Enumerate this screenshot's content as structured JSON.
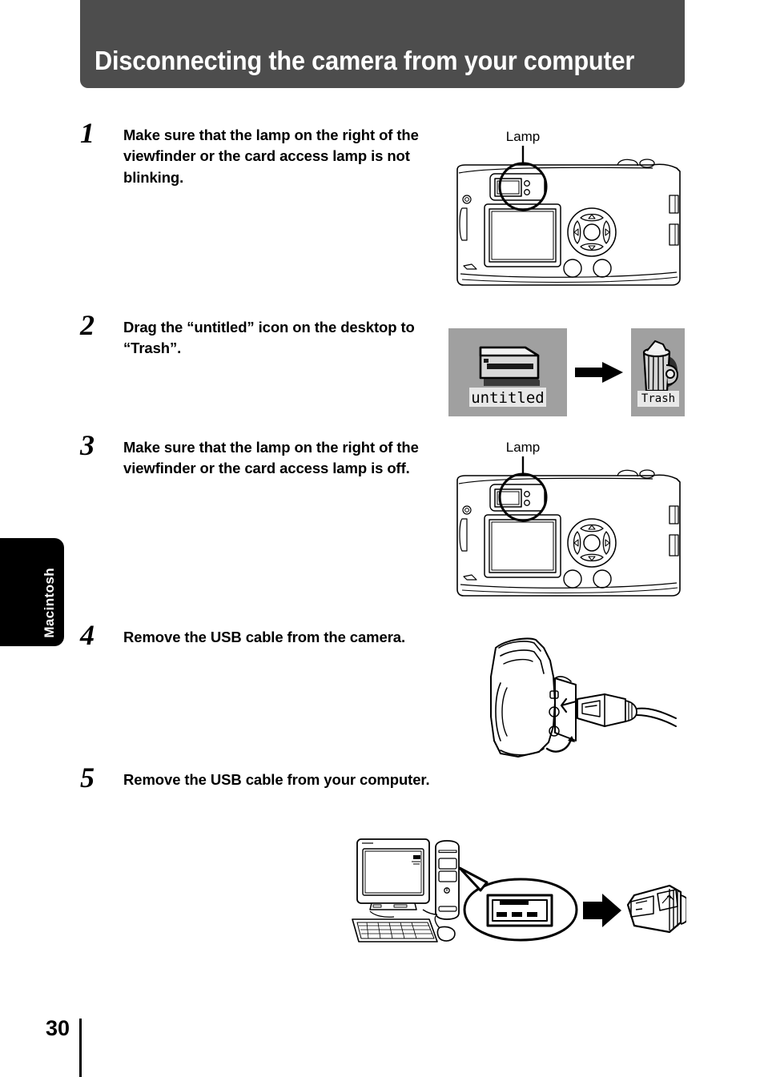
{
  "page": {
    "title": "Disconnecting the camera from your computer",
    "number": "30",
    "side_tab_label": "Macintosh"
  },
  "steps": [
    {
      "number": "1",
      "text": "Make sure that the lamp on the right of the viewfinder or the card access lamp is not blinking.",
      "figure": "camera-rear-view-with-lamp-callout",
      "figure_label": "Lamp"
    },
    {
      "number": "2",
      "text": "Drag the “untitled” icon on the desktop to “Trash”.",
      "figure": "untitled-icon-dragged-to-trash",
      "icons": {
        "source_label": "untitled",
        "target_label": "Trash"
      }
    },
    {
      "number": "3",
      "text": "Make sure that the lamp on the right of the viewfinder or the card access lamp is off.",
      "figure": "camera-rear-view-with-lamp-callout",
      "figure_label": "Lamp"
    },
    {
      "number": "4",
      "text": "Remove the USB cable from the camera.",
      "figure": "camera-side-usb-port-with-cable"
    },
    {
      "number": "5",
      "text": "Remove the USB cable from your computer.",
      "figure": "desktop-computer-usb-port-with-plug"
    }
  ],
  "colors": {
    "header_background": "#4d4d4d",
    "header_text": "#ffffff",
    "side_tab_background": "#000000",
    "side_tab_text": "#ffffff",
    "desktop_icon_background": "#a0a0a0",
    "icon_caption_background": "#e8e8e8",
    "line_art": "#000000"
  }
}
